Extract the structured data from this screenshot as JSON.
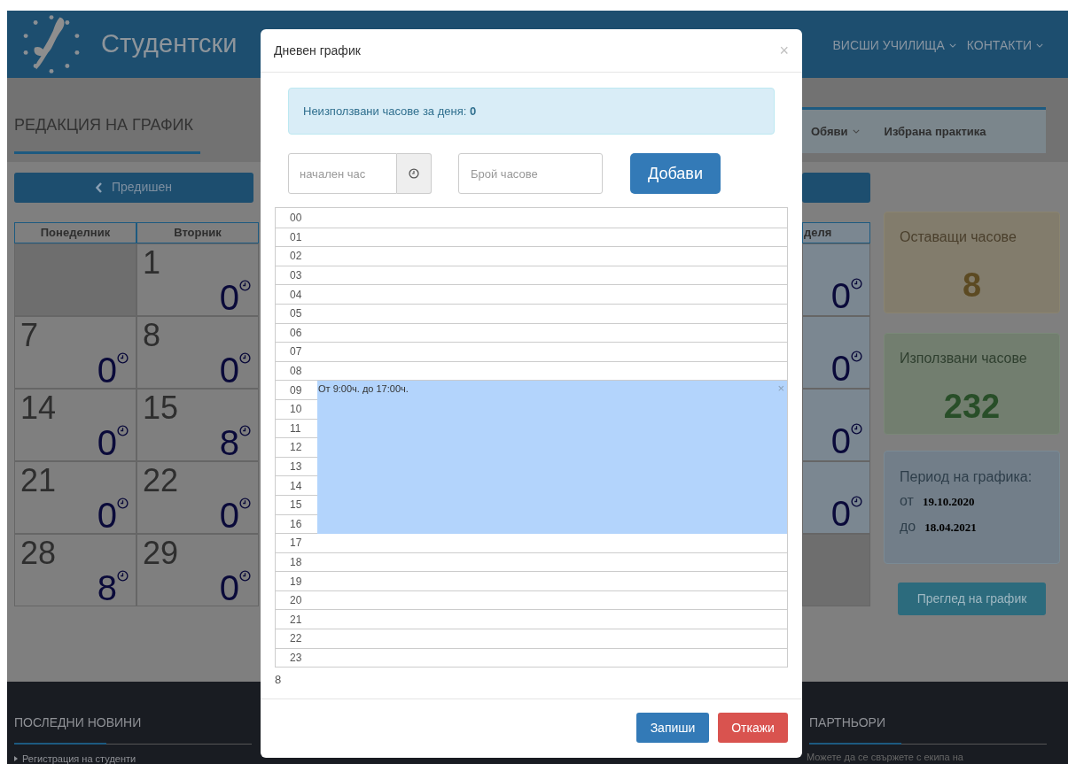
{
  "header": {
    "title": "Студентски",
    "nav": [
      {
        "label": "ВИСШИ УЧИЛИЩА"
      },
      {
        "label": "КОНТАКТИ"
      }
    ]
  },
  "page": {
    "heading": "РЕДАКЦИЯ НА ГРАФИК",
    "tabs": [
      {
        "label": "Обяви",
        "dropdown": true
      },
      {
        "label": "Избрана практика",
        "dropdown": false
      }
    ],
    "prev_button": "Предишен"
  },
  "calendar": {
    "columns": [
      {
        "label": "Понеделник",
        "kind": "weekday"
      },
      {
        "label": "Вторник",
        "kind": "weekday"
      },
      {
        "label": "деля",
        "kind": "weekend"
      }
    ],
    "rows": [
      [
        {
          "kind": "blank"
        },
        {
          "kind": "day",
          "day": "1",
          "hours": "0"
        },
        {
          "kind": "day",
          "hours": "0"
        }
      ],
      [
        {
          "kind": "day",
          "day": "7",
          "hours": "0"
        },
        {
          "kind": "day",
          "day": "8",
          "hours": "0"
        },
        {
          "kind": "day",
          "hours": "0"
        }
      ],
      [
        {
          "kind": "day",
          "day": "14",
          "hours": "0"
        },
        {
          "kind": "day",
          "day": "15",
          "hours": "8"
        },
        {
          "kind": "day",
          "hours": "0"
        }
      ],
      [
        {
          "kind": "day",
          "day": "21",
          "hours": "0"
        },
        {
          "kind": "day",
          "day": "22",
          "hours": "0"
        },
        {
          "kind": "day",
          "hours": "0"
        }
      ],
      [
        {
          "kind": "day",
          "day": "28",
          "hours": "8"
        },
        {
          "kind": "day",
          "day": "29",
          "hours": "0"
        },
        {
          "kind": "blank"
        }
      ]
    ]
  },
  "sidebar": {
    "stats": [
      {
        "kind": "remaining",
        "label": "Оставащи часове",
        "value": "8"
      },
      {
        "kind": "used",
        "label": "Използвани часове",
        "value": "232"
      }
    ],
    "period": {
      "label": "Период на графика:",
      "from_label": "от",
      "from": "19.10.2020",
      "to_label": "до",
      "to": "18.04.2021"
    },
    "view_button": "Преглед на график"
  },
  "footer": {
    "sections": [
      {
        "title": "ПОСЛЕДНИ НОВИНИ",
        "text": "Регистрация на студенти"
      },
      {
        "title": "ПАРТНЬОРИ"
      }
    ],
    "note": "Можете да се свържете с екипа на"
  },
  "modal": {
    "title": "Дневен график",
    "close": "×",
    "alert": "Неизползвани часове за деня: **0**",
    "start_field": {
      "placeholder": "начален час"
    },
    "hours_field": {
      "placeholder": "Брой часове"
    },
    "add_button": "Добави",
    "hours": [
      {
        "label": "00",
        "booked": false
      },
      {
        "label": "01",
        "booked": false
      },
      {
        "label": "02",
        "booked": false
      },
      {
        "label": "03",
        "booked": false
      },
      {
        "label": "04",
        "booked": false
      },
      {
        "label": "05",
        "booked": false
      },
      {
        "label": "06",
        "booked": false
      },
      {
        "label": "07",
        "booked": false
      },
      {
        "label": "08",
        "booked": false
      },
      {
        "label": "09",
        "booked": true
      },
      {
        "label": "10",
        "booked": true
      },
      {
        "label": "11",
        "booked": true
      },
      {
        "label": "12",
        "booked": true
      },
      {
        "label": "13",
        "booked": true
      },
      {
        "label": "14",
        "booked": true
      },
      {
        "label": "15",
        "booked": true
      },
      {
        "label": "16",
        "booked": true
      },
      {
        "label": "17",
        "booked": false
      },
      {
        "label": "18",
        "booked": false
      },
      {
        "label": "19",
        "booked": false
      },
      {
        "label": "20",
        "booked": false
      },
      {
        "label": "21",
        "booked": false
      },
      {
        "label": "22",
        "booked": false
      },
      {
        "label": "23",
        "booked": false
      }
    ],
    "event": {
      "label": "От 9:00ч. до 17:00ч.",
      "remove": "×"
    },
    "total": "8",
    "buttons": [
      {
        "label": "Запиши",
        "kind": "primary"
      },
      {
        "label": "Откажи",
        "kind": "danger"
      }
    ]
  }
}
